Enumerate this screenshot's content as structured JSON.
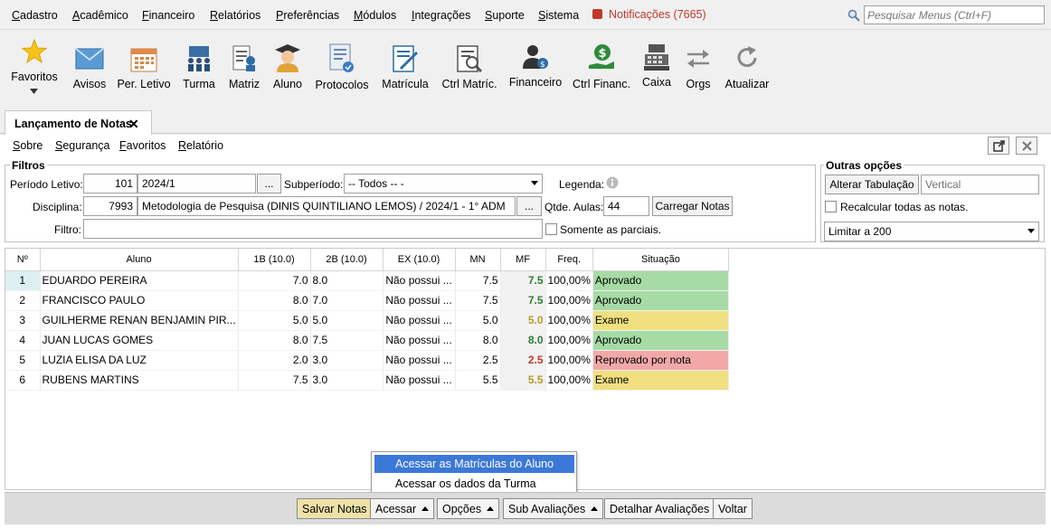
{
  "menu": [
    "Cadastro",
    "Acadêmico",
    "Financeiro",
    "Relatórios",
    "Preferências",
    "Módulos",
    "Integrações",
    "Suporte",
    "Sistema"
  ],
  "notifications": "Notificações (7665)",
  "search": {
    "placeholder": "Pesquisar Menus (Ctrl+F)"
  },
  "toolbar": {
    "favoritos": "Favoritos",
    "avisos": "Avisos",
    "per_letivo": "Per. Letivo",
    "turma": "Turma",
    "matriz": "Matriz",
    "aluno": "Aluno",
    "protocolos": "Protocolos",
    "matricula": "Matrícula",
    "ctrl_matric": "Ctrl Matríc.",
    "financeiro": "Financeiro",
    "ctrl_financ": "Ctrl Financ.",
    "caixa": "Caixa",
    "orgs": "Orgs",
    "atualizar": "Atualizar"
  },
  "tab": {
    "label": "Lançamento de Notas",
    "close": "✕"
  },
  "submenu": [
    "Sobre",
    "Segurança",
    "Favoritos",
    "Relatório"
  ],
  "filtros": {
    "title": "Filtros",
    "periodo_label": "Período Letivo:",
    "periodo_code": "101",
    "periodo_value": "2024/1",
    "browse": "...",
    "subperiodo_label": "Subperíodo:",
    "subperiodo_value": "-- Todos -- -",
    "legenda_label": "Legenda:",
    "disciplina_label": "Disciplina:",
    "disciplina_code": "7993",
    "disciplina_value": "Metodologia de Pesquisa (DINIS QUINTILIANO LEMOS) / 2024/1 - 1° ADM",
    "qtde_label": "Qtde. Aulas:",
    "qtde_value": "44",
    "carregar": "Carregar Notas",
    "filtro_label": "Filtro:",
    "filtro_value": "",
    "parciais": "Somente as parciais."
  },
  "outras": {
    "title": "Outras opções",
    "alterar": "Alterar Tabulação",
    "vertical_placeholder": "Vertical",
    "recalcular": "Recalcular todas as notas.",
    "limitar": "Limitar a 200"
  },
  "grid": {
    "headers": [
      "Nº",
      "Aluno",
      "1B (10.0)",
      "2B (10.0)",
      "EX (10.0)",
      "MN",
      "MF",
      "Freq.",
      "Situação"
    ],
    "rows": [
      {
        "n": "1",
        "aluno": "EDUARDO PEREIRA",
        "b1": "7.0",
        "b2": "8.0",
        "ex": "Não possui ...",
        "mn": "7.5",
        "mf": "7.5",
        "freq": "100,00%",
        "situacao": "Aprovado",
        "status": "aprovado"
      },
      {
        "n": "2",
        "aluno": "FRANCISCO PAULO",
        "b1": "8.0",
        "b2": "7.0",
        "ex": "Não possui ...",
        "mn": "7.5",
        "mf": "7.5",
        "freq": "100,00%",
        "situacao": "Aprovado",
        "status": "aprovado"
      },
      {
        "n": "3",
        "aluno": "GUILHERME RENAN BENJAMIN PIR...",
        "b1": "5.0",
        "b2": "5.0",
        "ex": "Não possui ...",
        "mn": "5.0",
        "mf": "5.0",
        "freq": "100,00%",
        "situacao": "Exame",
        "status": "exame"
      },
      {
        "n": "4",
        "aluno": "JUAN LUCAS GOMES",
        "b1": "8.0",
        "b2": "7.5",
        "ex": "Não possui ...",
        "mn": "8.0",
        "mf": "8.0",
        "freq": "100,00%",
        "situacao": "Aprovado",
        "status": "aprovado"
      },
      {
        "n": "5",
        "aluno": "LUZIA ELISA DA LUZ",
        "b1": "2.0",
        "b2": "3.0",
        "ex": "Não possui ...",
        "mn": "2.5",
        "mf": "2.5",
        "freq": "100,00%",
        "situacao": "Reprovado por nota",
        "status": "reprovado"
      },
      {
        "n": "6",
        "aluno": "RUBENS MARTINS",
        "b1": "7.5",
        "b2": "3.0",
        "ex": "Não possui ...",
        "mn": "5.5",
        "mf": "5.5",
        "freq": "100,00%",
        "situacao": "Exame",
        "status": "exame"
      }
    ]
  },
  "popup": [
    "Acessar as Matrículas do Aluno",
    "Acessar os dados da Turma"
  ],
  "bottom": {
    "salvar": "Salvar Notas",
    "acessar": "Acessar",
    "opcoes": "Opções",
    "sub": "Sub Avaliações",
    "detalhar": "Detalhar Avaliações",
    "voltar": "Voltar"
  }
}
